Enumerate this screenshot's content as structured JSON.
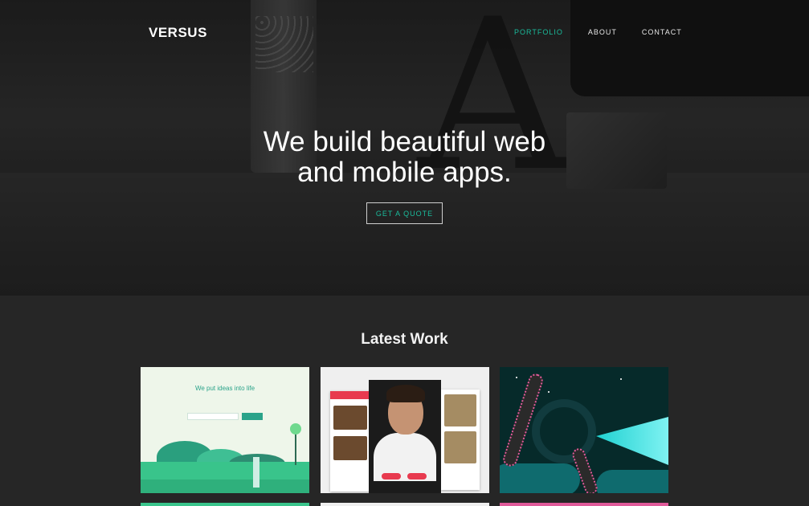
{
  "brand": {
    "logo": "VERSUS"
  },
  "nav": {
    "items": [
      {
        "label": "PORTFOLIO",
        "active": true
      },
      {
        "label": "ABOUT",
        "active": false
      },
      {
        "label": "CONTACT",
        "active": false
      }
    ]
  },
  "hero": {
    "headline_line1": "We build beautiful web",
    "headline_line2": "and mobile apps.",
    "cta_label": "GET A QUOTE"
  },
  "work": {
    "title": "Latest Work",
    "cards": [
      {
        "heading": "We put ideas into life",
        "underline_color": "#39c48b"
      },
      {
        "underline_color": "#efefef"
      },
      {
        "underline_color": "#e05a9a"
      }
    ]
  },
  "colors": {
    "accent": "#1abc9c",
    "background": "#262626"
  },
  "icons": [
    "lamp-photo",
    "letter-a-photo",
    "monitor-photo",
    "cube-photo"
  ]
}
